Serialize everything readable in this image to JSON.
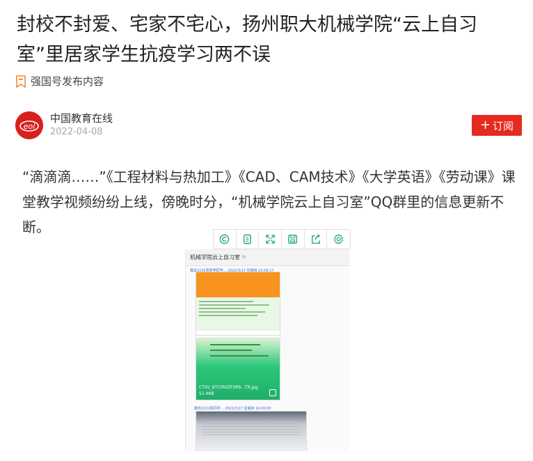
{
  "article": {
    "title": "封校不封爱、宅家不宅心，扬州职大机械学院“云上自习室”里居家学生抗疫学习两不误",
    "source_label": "强国号发布内容",
    "author": {
      "name": "中国教育在线",
      "date": "2022-04-08",
      "avatar_text": "eol"
    },
    "subscribe_label": "订阅",
    "body": "“滴滴滴……”《工程材料与热加工》《CAD、CAM技术》《大学英语》《劳动课》课堂教学视频纷纷上线，傍晚时分，“机械学院云上自习室”QQ群里的信息更新不断。"
  },
  "image_toolbar": {
    "tools": [
      "ocr-icon",
      "copy-icon",
      "expand-icon",
      "save-icon",
      "share-icon",
      "settings-icon"
    ]
  },
  "screenshot": {
    "group_title": "机械学院云上自习室",
    "msg1_meta": "模具2102周建明同学…  2022/3/17 星期四 15:56:17",
    "file_name": "CTSV_BT(5RVZP3R9...TR.jpg",
    "file_size": "51.4KB",
    "msg2_meta": "数控2101陈同学…  2022/3/17 星期四 16:00:00"
  },
  "colors": {
    "accent_red": "#e52b1f",
    "toolbar_green": "#2aa87a"
  }
}
